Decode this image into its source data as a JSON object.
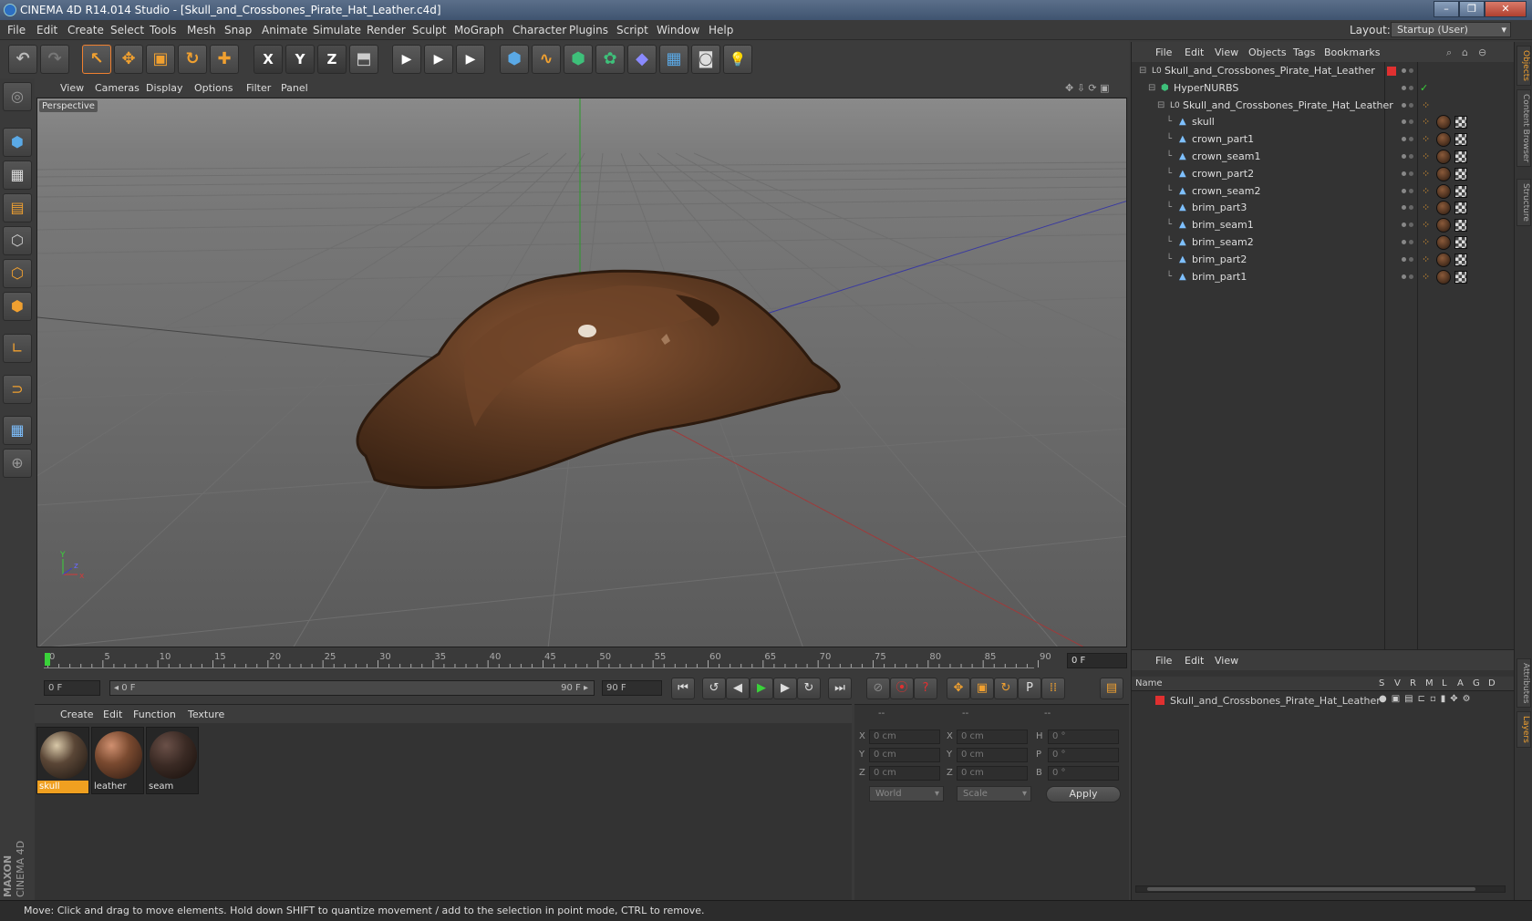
{
  "window": {
    "title": "CINEMA 4D R14.014 Studio - [Skull_and_Crossbones_Pirate_Hat_Leather.c4d]",
    "minimize": "–",
    "maximize": "❐",
    "close": "✕"
  },
  "menubar": {
    "items": [
      "File",
      "Edit",
      "Create",
      "Select",
      "Tools",
      "Mesh",
      "Snap",
      "Animate",
      "Simulate",
      "Render",
      "Sculpt",
      "MoGraph",
      "Character",
      "Plugins",
      "Script",
      "Window",
      "Help"
    ],
    "layout_label": "Layout:",
    "layout_value": "Startup (User)"
  },
  "toolbar": {
    "undo": "↶",
    "redo": "↷",
    "select": "↖",
    "move": "✥",
    "scale": "▣",
    "rotate": "↻",
    "add": "✚",
    "x": "X",
    "y": "Y",
    "z": "Z",
    "coord": "⬒",
    "render_view": "▶",
    "render_pic": "▶",
    "render_settings": "▶",
    "cube": "⬢",
    "spline": "∿",
    "nurbs": "⬢",
    "mograph": "✿",
    "deformer": "◆",
    "scene": "▦",
    "camera": "◙",
    "light": "💡"
  },
  "viewport": {
    "menu": [
      "View",
      "Cameras",
      "Display",
      "Options",
      "Filter",
      "Panel"
    ],
    "label": "Perspective",
    "axis_y": "Y",
    "axis_x": "x",
    "axis_z": "z"
  },
  "timeline": {
    "ticks": [
      "0",
      "5",
      "10",
      "15",
      "20",
      "25",
      "30",
      "35",
      "40",
      "45",
      "50",
      "55",
      "60",
      "65",
      "70",
      "75",
      "80",
      "85",
      "90"
    ],
    "current_frame": "0 F"
  },
  "transport": {
    "start": "0 F",
    "range_start": "◂ 0 F",
    "range_end": "90 F ▸",
    "end": "90 F",
    "btn_first": "⏮",
    "btn_prev_key": "↺",
    "btn_prev": "◀",
    "btn_play": "▶",
    "btn_next": "▶",
    "btn_next_key": "↻",
    "btn_last": "⏭",
    "btn_autokey": "⊘",
    "btn_record": "⦿",
    "btn_help": "?",
    "btn_pos": "✥",
    "btn_scl": "▣",
    "btn_rot": "↻",
    "btn_param": "P",
    "btn_pla": "⁞⁞",
    "btn_timeline": "▤"
  },
  "material_manager": {
    "menu": [
      "Create",
      "Edit",
      "Function",
      "Texture"
    ],
    "materials": [
      {
        "name": "skull",
        "selected": true,
        "color": "#5a4636"
      },
      {
        "name": "leather",
        "selected": false,
        "color": "#7a4a30"
      },
      {
        "name": "seam",
        "selected": false,
        "color": "#3a2a24"
      }
    ]
  },
  "coordinates": {
    "header": [
      "--",
      "--",
      "--"
    ],
    "rows": [
      {
        "l1": "X",
        "v1": "0 cm",
        "l2": "X",
        "v2": "0 cm",
        "l3": "H",
        "v3": "0 °"
      },
      {
        "l1": "Y",
        "v1": "0 cm",
        "l2": "Y",
        "v2": "0 cm",
        "l3": "P",
        "v3": "0 °"
      },
      {
        "l1": "Z",
        "v1": "0 cm",
        "l2": "Z",
        "v2": "0 cm",
        "l3": "B",
        "v3": "0 °"
      }
    ],
    "space": "World",
    "mode": "Scale",
    "apply": "Apply"
  },
  "object_manager": {
    "menu": [
      "File",
      "Edit",
      "View",
      "Objects",
      "Tags",
      "Bookmarks"
    ],
    "objects": [
      {
        "name": "Skull_and_Crossbones_Pirate_Hat_Leather",
        "level": 0,
        "icon": "L0",
        "tags": "none",
        "red": true
      },
      {
        "name": "HyperNURBS",
        "level": 1,
        "icon": "⬢",
        "tags": "check"
      },
      {
        "name": "Skull_and_Crossbones_Pirate_Hat_Leather",
        "level": 2,
        "icon": "L0",
        "tags": "phong"
      },
      {
        "name": "skull",
        "level": 3,
        "icon": "▲",
        "tags": "full"
      },
      {
        "name": "crown_part1",
        "level": 3,
        "icon": "▲",
        "tags": "full"
      },
      {
        "name": "crown_seam1",
        "level": 3,
        "icon": "▲",
        "tags": "full"
      },
      {
        "name": "crown_part2",
        "level": 3,
        "icon": "▲",
        "tags": "full"
      },
      {
        "name": "crown_seam2",
        "level": 3,
        "icon": "▲",
        "tags": "full"
      },
      {
        "name": "brim_part3",
        "level": 3,
        "icon": "▲",
        "tags": "full"
      },
      {
        "name": "brim_seam1",
        "level": 3,
        "icon": "▲",
        "tags": "full"
      },
      {
        "name": "brim_seam2",
        "level": 3,
        "icon": "▲",
        "tags": "full"
      },
      {
        "name": "brim_part2",
        "level": 3,
        "icon": "▲",
        "tags": "full"
      },
      {
        "name": "brim_part1",
        "level": 3,
        "icon": "▲",
        "tags": "full"
      }
    ]
  },
  "layer_manager": {
    "menu": [
      "File",
      "Edit",
      "View"
    ],
    "columns": [
      "Name",
      "S",
      "V",
      "R",
      "M",
      "L",
      "A",
      "G",
      "D"
    ],
    "layers": [
      {
        "name": "Skull_and_Crossbones_Pirate_Hat_Leather",
        "color": "#e03030"
      }
    ]
  },
  "right_tabs": [
    "Objects",
    "Content Browser",
    "Structure",
    "Attributes",
    "Layers"
  ],
  "status": "Move: Click and drag to move elements. Hold down SHIFT to quantize movement / add to the selection in point mode, CTRL to remove.",
  "brand": {
    "maxon": "MAXON",
    "product": "CINEMA 4D"
  }
}
